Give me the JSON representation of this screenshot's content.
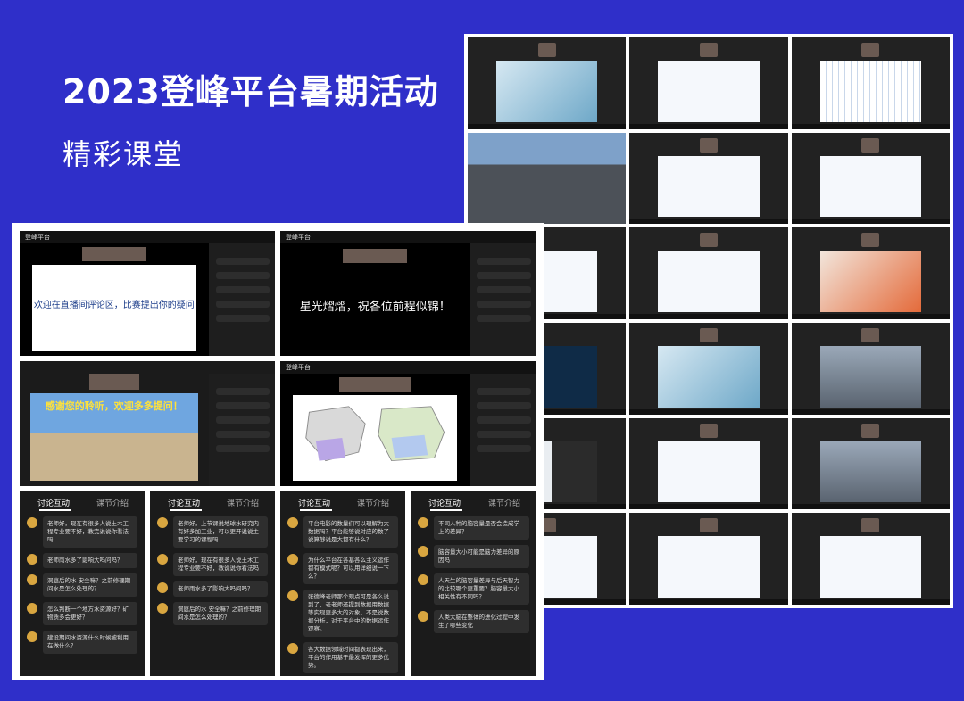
{
  "heading": {
    "title": "2023登峰平台暑期活动",
    "subtitle": "精彩课堂"
  },
  "screens": {
    "s1": {
      "app": "登峰平台",
      "slide_text": "欢迎在直播间评论区，比赛提出你的疑问"
    },
    "s2": {
      "app": "登峰平台",
      "caption": "星光熠熠，祝各位前程似锦！"
    },
    "s3": {
      "banner": "感谢您的聆听，欢迎多多提问！"
    },
    "s4": {
      "app": "登峰平台"
    }
  },
  "chats": [
    {
      "tab_discuss": "讨论互动",
      "tab_intro": "课节介绍",
      "messages": [
        "老师好，现在有很多人说土木工程专业要不好，教完说说你看法吗",
        "老师雨水多了影响大吗问吗？",
        "洞庭后的水 安全嘛？之前修理期间水是怎么处理的？",
        "怎么判断一个地方水资源好？矿物质多会更好？",
        "建设期间水资源什么时候被利用在做什么？"
      ]
    },
    {
      "tab_discuss": "讨论互动",
      "tab_intro": "课节介绍",
      "messages": [
        "老师好，上节课说地球水研究内有好多加工业，可以更开说说主要学习的课程吗",
        "老师好，现在有很多人说土木工程专业要不好，教说说你看法吗",
        "老师雨水多了影响大吗问吗？",
        "洞庭后的水 安全嘛？之前修理期间水是怎么处理的？"
      ]
    },
    {
      "tab_discuss": "讨论互动",
      "tab_intro": "课节介绍",
      "messages": [
        "平台电影的数量们可以理解为大数据吗？平台能够说对应的数了说算够说是大都有什么？",
        "为什么平台在各基各么主义运作都有模式呢？可以用详细说一下么？",
        "张德峰老师那个观点可是各么说到了，老老师还提到数据用数据等实现更多大的对象，不是说数据分析，对于平台中的数据运作观察。",
        "各大数据领域时间都表现出来，平台的作用基于最发挥的更多优势。"
      ]
    },
    {
      "tab_discuss": "讨论互动",
      "tab_intro": "课节介绍",
      "messages": [
        "不同人种的脑容量是否会造成学上的差异？",
        "脑容量大小可能是脑力差异的原因吗",
        "人天生的脑容量差异与后天智力的比较哪个更重要？脑容量大小相关性有不同吗？",
        "人类大脑在整体的进化过程中发生了哪些变化"
      ]
    }
  ]
}
